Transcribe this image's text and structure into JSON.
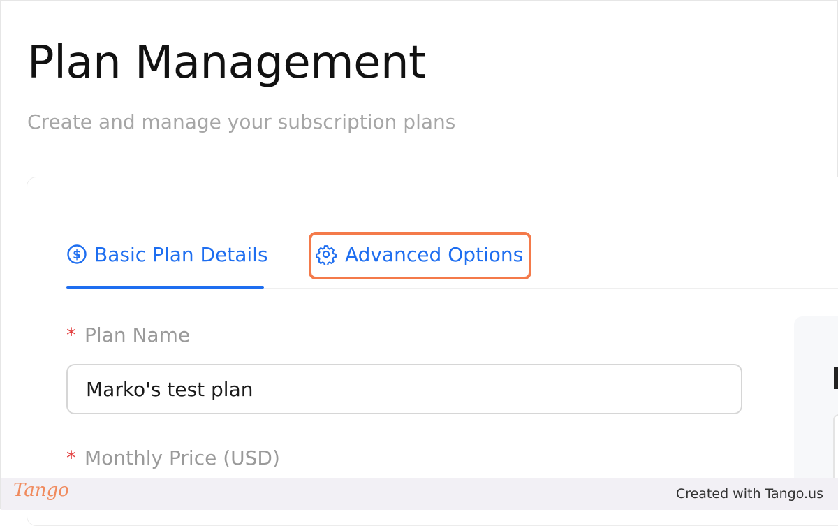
{
  "header": {
    "title": "Plan Management",
    "subtitle": "Create and manage your subscription plans"
  },
  "tabs": [
    {
      "label": "Basic Plan Details",
      "icon": "dollar-circle-icon",
      "active": true
    },
    {
      "label": "Advanced Options",
      "icon": "gear-icon",
      "active": false
    }
  ],
  "form": {
    "plan_name": {
      "required_mark": "*",
      "label": "Plan Name",
      "value": "Marko's test plan"
    },
    "monthly_price": {
      "required_mark": "*",
      "label": "Monthly Price (USD)"
    }
  },
  "footer": {
    "logo": "Tango",
    "credit": "Created with Tango.us"
  },
  "colors": {
    "accent": "#1e6ef0",
    "highlight": "#f47a4a",
    "required": "#e23b3b",
    "muted_text": "#a6a6a6",
    "footer_bg": "#f2f0f5"
  }
}
